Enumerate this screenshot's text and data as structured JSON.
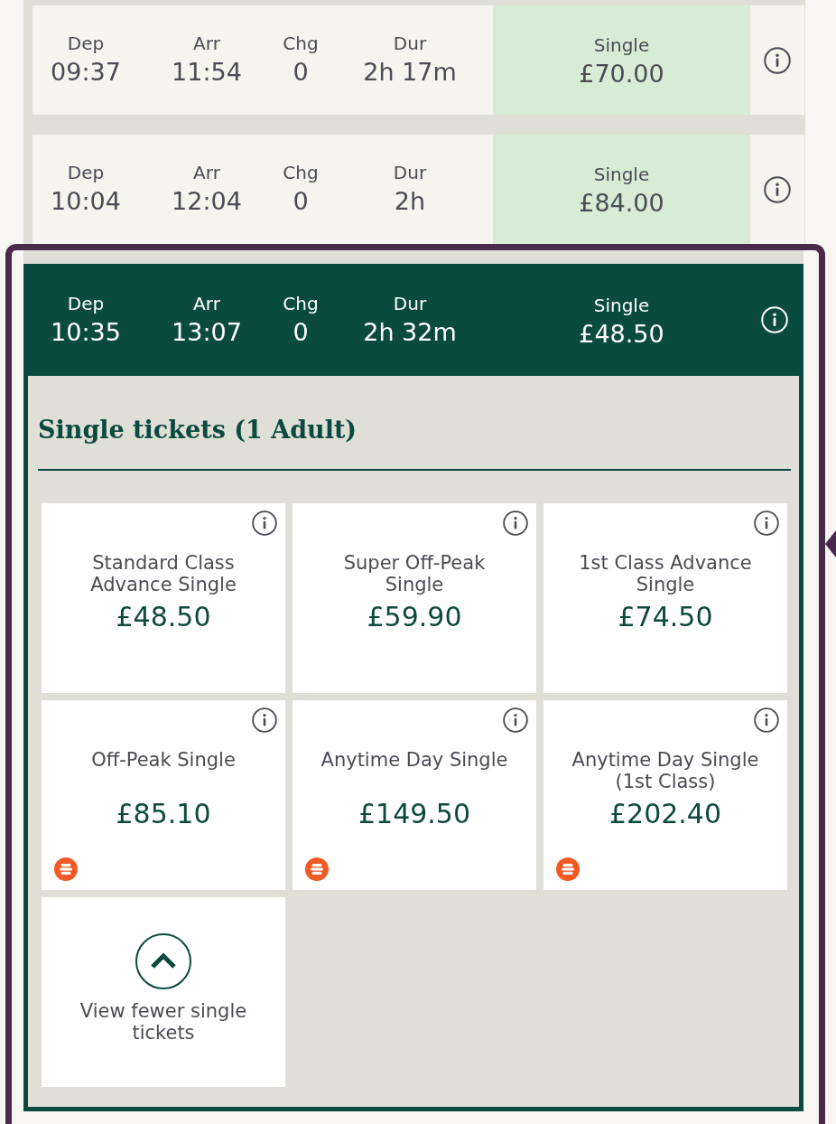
{
  "journeys": [
    {
      "selected": false,
      "expanded": false,
      "columns": [
        {
          "label": "Dep",
          "value": "09:37"
        },
        {
          "label": "Arr",
          "value": "11:54"
        },
        {
          "label": "Chg",
          "value": "0"
        },
        {
          "label": "Dur",
          "value": "2h 17m"
        }
      ],
      "fare": {
        "label": "Single",
        "price": "£70.00"
      }
    },
    {
      "selected": false,
      "expanded": false,
      "columns": [
        {
          "label": "Dep",
          "value": "10:04"
        },
        {
          "label": "Arr",
          "value": "12:04"
        },
        {
          "label": "Chg",
          "value": "0"
        },
        {
          "label": "Dur",
          "value": "2h"
        }
      ],
      "fare": {
        "label": "Single",
        "price": "£84.00"
      }
    },
    {
      "selected": true,
      "expanded": true,
      "columns": [
        {
          "label": "Dep",
          "value": "10:35"
        },
        {
          "label": "Arr",
          "value": "13:07"
        },
        {
          "label": "Chg",
          "value": "0"
        },
        {
          "label": "Dur",
          "value": "2h 32m"
        }
      ],
      "fare": {
        "label": "Single",
        "price": "£48.50"
      },
      "tickets_panel": {
        "heading": "Single tickets (1 Adult)",
        "tickets": [
          {
            "name": "Standard Class Advance Single",
            "price": "£48.50",
            "badge": false
          },
          {
            "name": "Super Off-Peak Single",
            "price": "£59.90",
            "badge": false
          },
          {
            "name": "1st Class Advance Single",
            "price": "£74.50",
            "badge": false
          },
          {
            "name": "Off-Peak Single",
            "price": "£85.10",
            "badge": true
          },
          {
            "name": "Anytime Day Single",
            "price": "£149.50",
            "badge": true
          },
          {
            "name": "Anytime Day Single (1st Class)",
            "price": "£202.40",
            "badge": true
          }
        ],
        "view_fewer": {
          "label": "View fewer single tickets"
        }
      }
    }
  ]
}
